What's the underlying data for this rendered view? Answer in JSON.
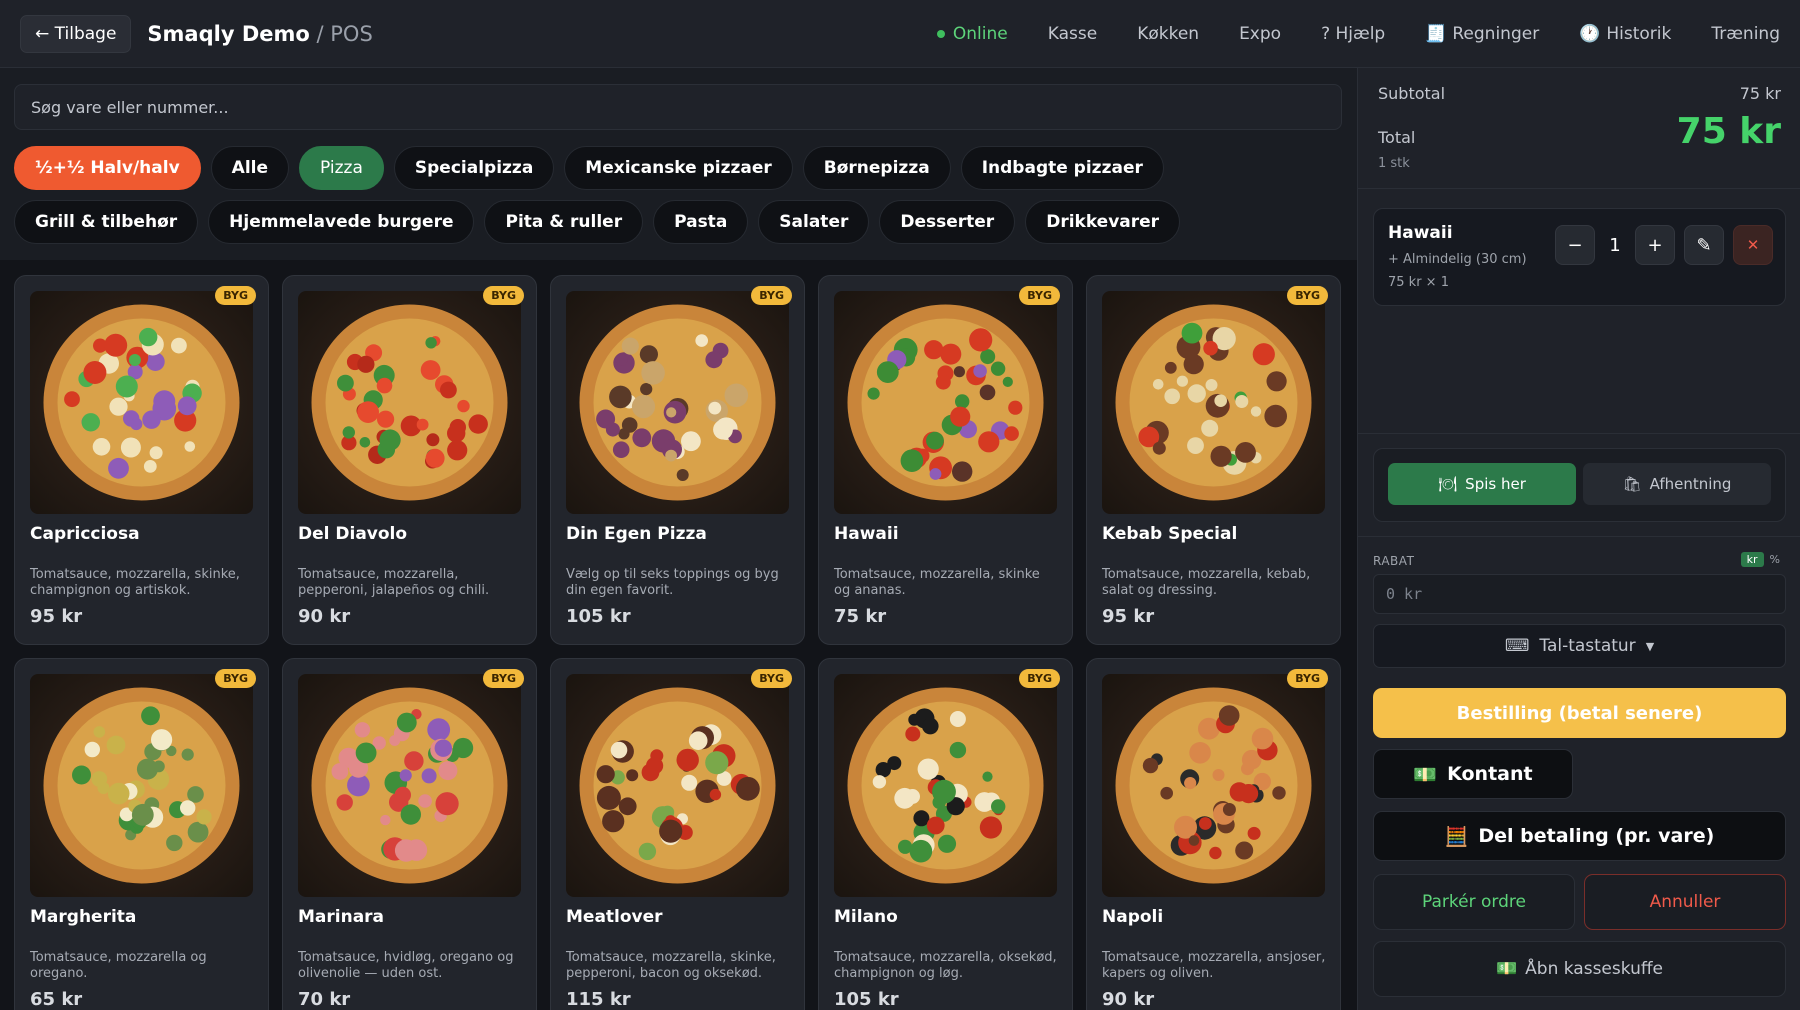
{
  "topbar": {
    "back_label": "← Tilbage",
    "brand_name": "Smaqly Demo",
    "brand_sep": " / POS",
    "nav": {
      "online": "Online",
      "kasse": "Kasse",
      "kokken": "Køkken",
      "expo": "Expo",
      "help": "? Hjælp",
      "bills": "Regninger",
      "history": "Historik",
      "training": "Træning"
    }
  },
  "search": {
    "placeholder": "Søg vare eller nummer..."
  },
  "categories": [
    "½+½ Halv/halv",
    "Alle",
    "Pizza",
    "Specialpizza",
    "Mexicanske pizzaer",
    "Børnepizza",
    "Indbagte pizzaer",
    "Grill & tilbehør",
    "Hjemmelavede burgere",
    "Pita & ruller",
    "Pasta",
    "Salater",
    "Desserter",
    "Drikkevarer"
  ],
  "badge_label": "BYG",
  "products": [
    {
      "name": "Capricciosa",
      "desc": "Tomatsauce, mozzarella, skinke, champignon og artiskok.",
      "price": "95 kr"
    },
    {
      "name": "Del Diavolo",
      "desc": "Tomatsauce, mozzarella, pepperoni, jalapeños og chili.",
      "price": "90 kr"
    },
    {
      "name": "Din Egen Pizza",
      "desc": "Vælg op til seks toppings og byg din egen favorit.",
      "price": "105 kr"
    },
    {
      "name": "Hawaii",
      "desc": "Tomatsauce, mozzarella, skinke og ananas.",
      "price": "75 kr"
    },
    {
      "name": "Kebab Special",
      "desc": "Tomatsauce, mozzarella, kebab, salat og dressing.",
      "price": "95 kr"
    },
    {
      "name": "Margherita",
      "desc": "Tomatsauce, mozzarella og oregano.",
      "price": "65 kr"
    },
    {
      "name": "Marinara",
      "desc": "Tomatsauce, hvidløg, oregano og olivenolie — uden ost.",
      "price": "70 kr"
    },
    {
      "name": "Meatlover",
      "desc": "Tomatsauce, mozzarella, skinke, pepperoni, bacon og oksekød.",
      "price": "115 kr"
    },
    {
      "name": "Milano",
      "desc": "Tomatsauce, mozzarella, oksekød, champignon og løg.",
      "price": "105 kr"
    },
    {
      "name": "Napoli",
      "desc": "Tomatsauce, mozzarella, ansjoser, kapers og oliven.",
      "price": "90 kr"
    }
  ],
  "cart": {
    "subtotal_label": "Subtotal",
    "subtotal_value": "75 kr",
    "total_label": "Total",
    "total_value": "75 kr",
    "count": "1 stk",
    "item": {
      "name": "Hawaii",
      "modifier": "+ Almindelig (30 cm)",
      "price_line": "75 kr × 1",
      "qty": "1"
    },
    "mode_eat": "Spis her",
    "mode_pickup": "Afhentning",
    "discount_label": "RABAT",
    "discount_unit_kr": "kr",
    "discount_unit_pct": "%",
    "discount_placeholder": "0 kr",
    "keypad_label": "Tal-tastatur",
    "order_label": "Bestilling (betal senere)",
    "cash_label": "Kontant",
    "split_label": "Del betaling (pr. vare)",
    "park_label": "Parkér ordre",
    "cancel_label": "Annuller",
    "drawer_label": "Åbn kasseskuffe"
  },
  "colors": {
    "accent_green": "#45d36a",
    "halfhalf_orange": "#ef5a30",
    "badge_yellow": "#f2b93b",
    "order_yellow": "#f5c04a",
    "cancel_red": "#f05a4a"
  }
}
